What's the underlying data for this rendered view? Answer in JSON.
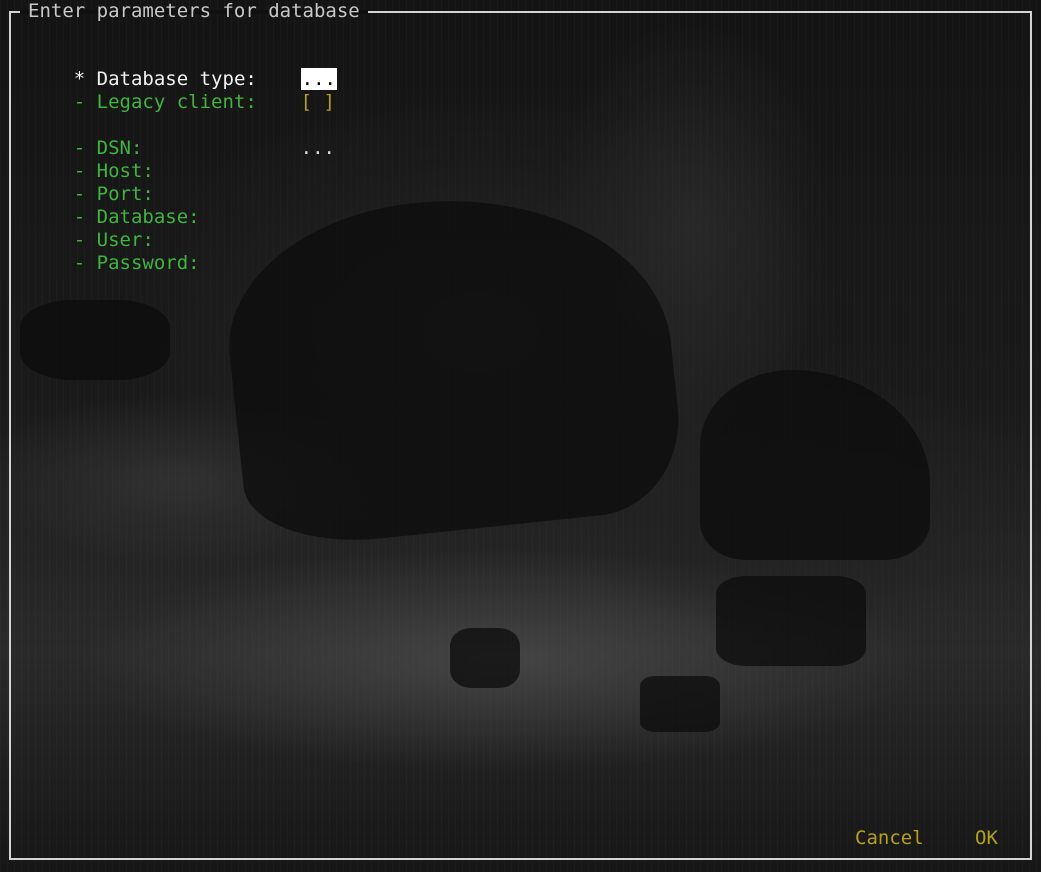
{
  "dialog": {
    "title": "Enter parameters for database"
  },
  "fields": [
    {
      "marker": "*",
      "label": "Database type:",
      "value": "..."
    },
    {
      "marker": "-",
      "label": "Legacy client:",
      "value": "[ ]"
    },
    {
      "marker": "-",
      "label": "DSN:",
      "value": "..."
    },
    {
      "marker": "-",
      "label": "Host:",
      "value": ""
    },
    {
      "marker": "-",
      "label": "Port:",
      "value": ""
    },
    {
      "marker": "-",
      "label": "Database:",
      "value": ""
    },
    {
      "marker": "-",
      "label": "User:",
      "value": ""
    },
    {
      "marker": "-",
      "label": "Password:",
      "value": ""
    }
  ],
  "buttons": {
    "cancel": "Cancel",
    "ok": "OK"
  },
  "colors": {
    "border": "#d4d4d4",
    "title": "#d8d8d8",
    "active_label": "#f2f2f2",
    "inactive_label": "#3fb43f",
    "checkbox": "#b5a214",
    "button": "#b5a214",
    "selection_bg": "#ffffff"
  }
}
